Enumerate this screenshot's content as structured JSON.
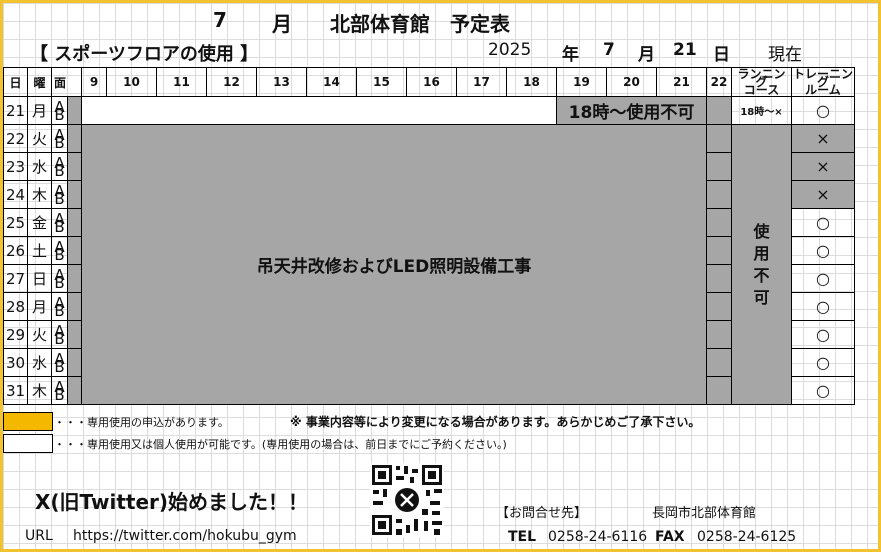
{
  "header": {
    "month": "7",
    "month_unit": "月",
    "title": "北部体育館　予定表",
    "facility": "【 スポーツフロアの使用 】",
    "year": "2025",
    "year_unit": "年",
    "date_month": "7",
    "date_month_unit": "月",
    "date_day": "21",
    "date_day_unit": "日",
    "status": "現在"
  },
  "table": {
    "col_day": "日",
    "col_weekday": "曜",
    "col_side": "面",
    "hours": [
      "9",
      "10",
      "11",
      "12",
      "13",
      "14",
      "15",
      "16",
      "17",
      "18",
      "19",
      "20",
      "21",
      "22"
    ],
    "col_running": "ランニング\nコース",
    "col_training": "トレーニング\nルーム",
    "ab_label": "A\nB",
    "rows": [
      {
        "day": "21",
        "weekday": "月",
        "running": "18時～×",
        "training": "○"
      },
      {
        "day": "22",
        "weekday": "火",
        "running": "",
        "training": "×"
      },
      {
        "day": "23",
        "weekday": "水",
        "running": "",
        "training": "×"
      },
      {
        "day": "24",
        "weekday": "木",
        "running": "",
        "training": "×"
      },
      {
        "day": "25",
        "weekday": "金",
        "running": "",
        "training": "○"
      },
      {
        "day": "26",
        "weekday": "土",
        "running": "",
        "training": "○"
      },
      {
        "day": "27",
        "weekday": "日",
        "running": "",
        "training": "○"
      },
      {
        "day": "28",
        "weekday": "月",
        "running": "",
        "training": "○"
      },
      {
        "day": "29",
        "weekday": "火",
        "running": "",
        "training": "○"
      },
      {
        "day": "30",
        "weekday": "水",
        "running": "",
        "training": "○"
      },
      {
        "day": "31",
        "weekday": "木",
        "running": "",
        "training": "○"
      }
    ],
    "notice_18": "18時～使用不可",
    "construction": "吊天井改修およびLED照明設備工事",
    "running_closed": "使\n用\n不\n可"
  },
  "legend": {
    "yellow_text": "・・・専用使用の申込があります。",
    "white_text": "・・・専用使用又は個人使用が可能です。(専用使用の場合は、前日までにご予約ください。)",
    "caution": "※ 事業内容等により変更になる場合があります。あらかじめご了承下さい。",
    "yellow_color": "#f5b800"
  },
  "footer": {
    "twitter_msg": "X(旧Twitter)始めました！！",
    "url_label": "URL",
    "url": "https://twitter.com/hokubu_gym",
    "contact_label": "【お問合せ先】",
    "org": "長岡市北部体育館",
    "tel_label": "TEL",
    "tel": "0258-24-6116",
    "fax_label": "FAX",
    "fax": "0258-24-6125"
  },
  "colors": {
    "frame": "#f2c230",
    "gray": "#a6a6a6"
  }
}
